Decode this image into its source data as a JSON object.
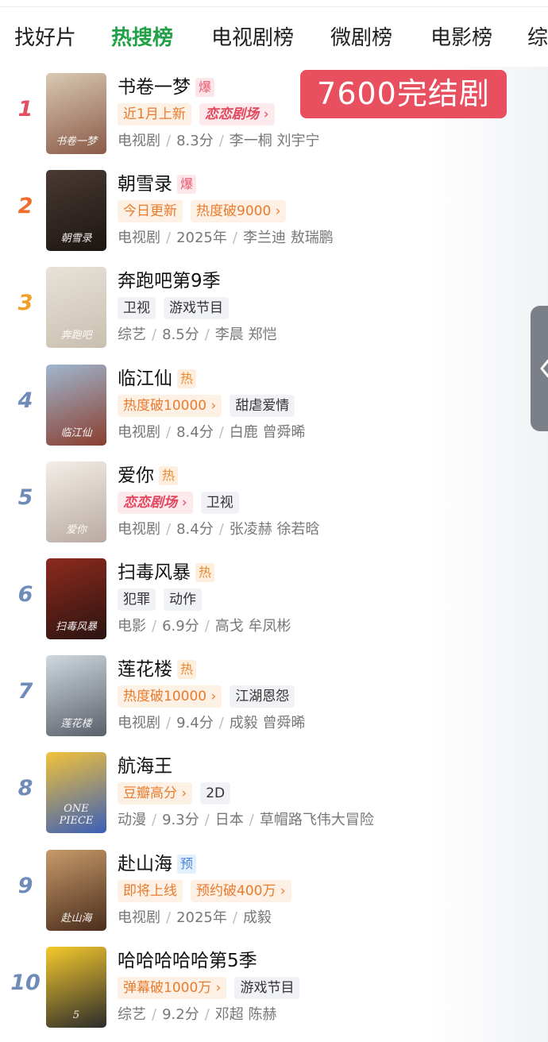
{
  "tabs": [
    "找好片",
    "热搜榜",
    "电视剧榜",
    "微剧榜",
    "电影榜",
    "综"
  ],
  "active_tab": 1,
  "overlay_badge": "7600完结剧",
  "list": [
    {
      "rank": "1",
      "title": "书卷一梦",
      "hot": "爆",
      "hot_type": "bao",
      "tags": [
        {
          "text": "近1月上新",
          "style": "orange",
          "chevron": false
        },
        {
          "text": "恋恋剧场",
          "style": "pink",
          "chevron": true
        }
      ],
      "meta": [
        "电视剧",
        "8.3分",
        "李一桐 刘宇宁"
      ],
      "poster_text": "书卷一梦",
      "poster_colors": [
        "#d9c9b3",
        "#8a5a48"
      ]
    },
    {
      "rank": "2",
      "title": "朝雪录",
      "hot": "爆",
      "hot_type": "bao",
      "tags": [
        {
          "text": "今日更新",
          "style": "orange",
          "chevron": false
        },
        {
          "text": "热度破9000",
          "style": "orange",
          "chevron": true
        }
      ],
      "meta": [
        "电视剧",
        "2025年",
        "李兰迪 敖瑞鹏"
      ],
      "poster_text": "朝雪录",
      "poster_colors": [
        "#4a3a34",
        "#1c1512"
      ]
    },
    {
      "rank": "3",
      "title": "奔跑吧第9季",
      "hot": "",
      "hot_type": "",
      "tags": [
        {
          "text": "卫视",
          "style": "gray",
          "chevron": false
        },
        {
          "text": "游戏节目",
          "style": "gray",
          "chevron": false
        }
      ],
      "meta": [
        "综艺",
        "8.5分",
        "李晨 郑恺"
      ],
      "poster_text": "奔跑吧",
      "poster_colors": [
        "#e8e2d8",
        "#c9bfb0"
      ]
    },
    {
      "rank": "4",
      "title": "临江仙",
      "hot": "热",
      "hot_type": "re",
      "tags": [
        {
          "text": "热度破10000",
          "style": "orange",
          "chevron": true
        },
        {
          "text": "甜虐爱情",
          "style": "gray",
          "chevron": false
        }
      ],
      "meta": [
        "电视剧",
        "8.4分",
        "白鹿 曾舜晞"
      ],
      "poster_text": "临江仙",
      "poster_colors": [
        "#9fb7cf",
        "#8a3d2e"
      ]
    },
    {
      "rank": "5",
      "title": "爱你",
      "hot": "热",
      "hot_type": "re",
      "tags": [
        {
          "text": "恋恋剧场",
          "style": "pink",
          "chevron": true
        },
        {
          "text": "卫视",
          "style": "gray",
          "chevron": false
        }
      ],
      "meta": [
        "电视剧",
        "8.4分",
        "张凌赫 徐若晗"
      ],
      "poster_text": "爱你",
      "poster_colors": [
        "#f3eee8",
        "#b9aaa0"
      ]
    },
    {
      "rank": "6",
      "title": "扫毒风暴",
      "hot": "热",
      "hot_type": "re",
      "tags": [
        {
          "text": "犯罪",
          "style": "gray",
          "chevron": false
        },
        {
          "text": "动作",
          "style": "gray",
          "chevron": false
        }
      ],
      "meta": [
        "电影",
        "6.9分",
        "高戈 牟凤彬"
      ],
      "poster_text": "扫毒风暴",
      "poster_colors": [
        "#8e2a1e",
        "#2a1410"
      ]
    },
    {
      "rank": "7",
      "title": "莲花楼",
      "hot": "热",
      "hot_type": "re",
      "tags": [
        {
          "text": "热度破10000",
          "style": "orange",
          "chevron": true
        },
        {
          "text": "江湖恩怨",
          "style": "gray",
          "chevron": false
        }
      ],
      "meta": [
        "电视剧",
        "9.4分",
        "成毅 曾舜晞"
      ],
      "poster_text": "莲花楼",
      "poster_colors": [
        "#cfd9de",
        "#5a5f6a"
      ]
    },
    {
      "rank": "8",
      "title": "航海王",
      "hot": "",
      "hot_type": "",
      "tags": [
        {
          "text": "豆瓣高分",
          "style": "orange",
          "chevron": true
        },
        {
          "text": "2D",
          "style": "gray",
          "chevron": false
        }
      ],
      "meta": [
        "动漫",
        "9.3分",
        "日本",
        "草帽路飞伟大冒险"
      ],
      "poster_text": "ONE PIECE",
      "poster_colors": [
        "#f2c23a",
        "#3b5fb8"
      ]
    },
    {
      "rank": "9",
      "title": "赴山海",
      "hot": "预",
      "hot_type": "yu",
      "tags": [
        {
          "text": "即将上线",
          "style": "orange",
          "chevron": false
        },
        {
          "text": "预约破400万",
          "style": "orange",
          "chevron": true
        }
      ],
      "meta": [
        "电视剧",
        "2025年",
        "成毅"
      ],
      "poster_text": "赴山海",
      "poster_colors": [
        "#c79a6a",
        "#4a2d1c"
      ]
    },
    {
      "rank": "10",
      "title": "哈哈哈哈哈第5季",
      "hot": "",
      "hot_type": "",
      "tags": [
        {
          "text": "弹幕破1000万",
          "style": "orange",
          "chevron": true
        },
        {
          "text": "游戏节目",
          "style": "gray",
          "chevron": false
        }
      ],
      "meta": [
        "综艺",
        "9.2分",
        "邓超 陈赫"
      ],
      "poster_text": "5",
      "poster_colors": [
        "#f5c92c",
        "#2b2b2b"
      ]
    }
  ],
  "icons": {
    "chevron": "›",
    "float_button": "float-side-icon"
  }
}
